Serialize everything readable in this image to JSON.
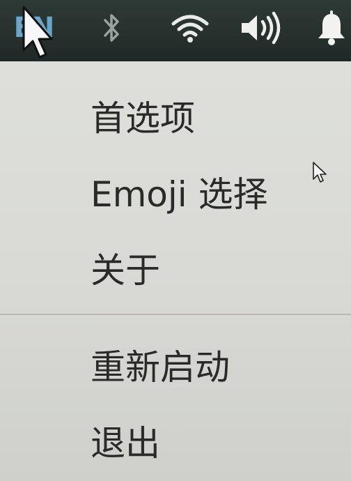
{
  "tray": {
    "language": "EN",
    "icons": [
      "bluetooth-icon",
      "wifi-icon",
      "volume-icon",
      "bell-icon"
    ]
  },
  "menu": {
    "items": [
      {
        "label": "首选项"
      },
      {
        "label": "Emoji 选择"
      },
      {
        "label": "关于"
      },
      {
        "label": "重新启动"
      },
      {
        "label": "退出"
      }
    ]
  },
  "colors": {
    "topbar": "#26302d",
    "menu_bg": "#dadbd7",
    "text": "#2a2a2a",
    "lang_accent": "#6aa6c9"
  }
}
